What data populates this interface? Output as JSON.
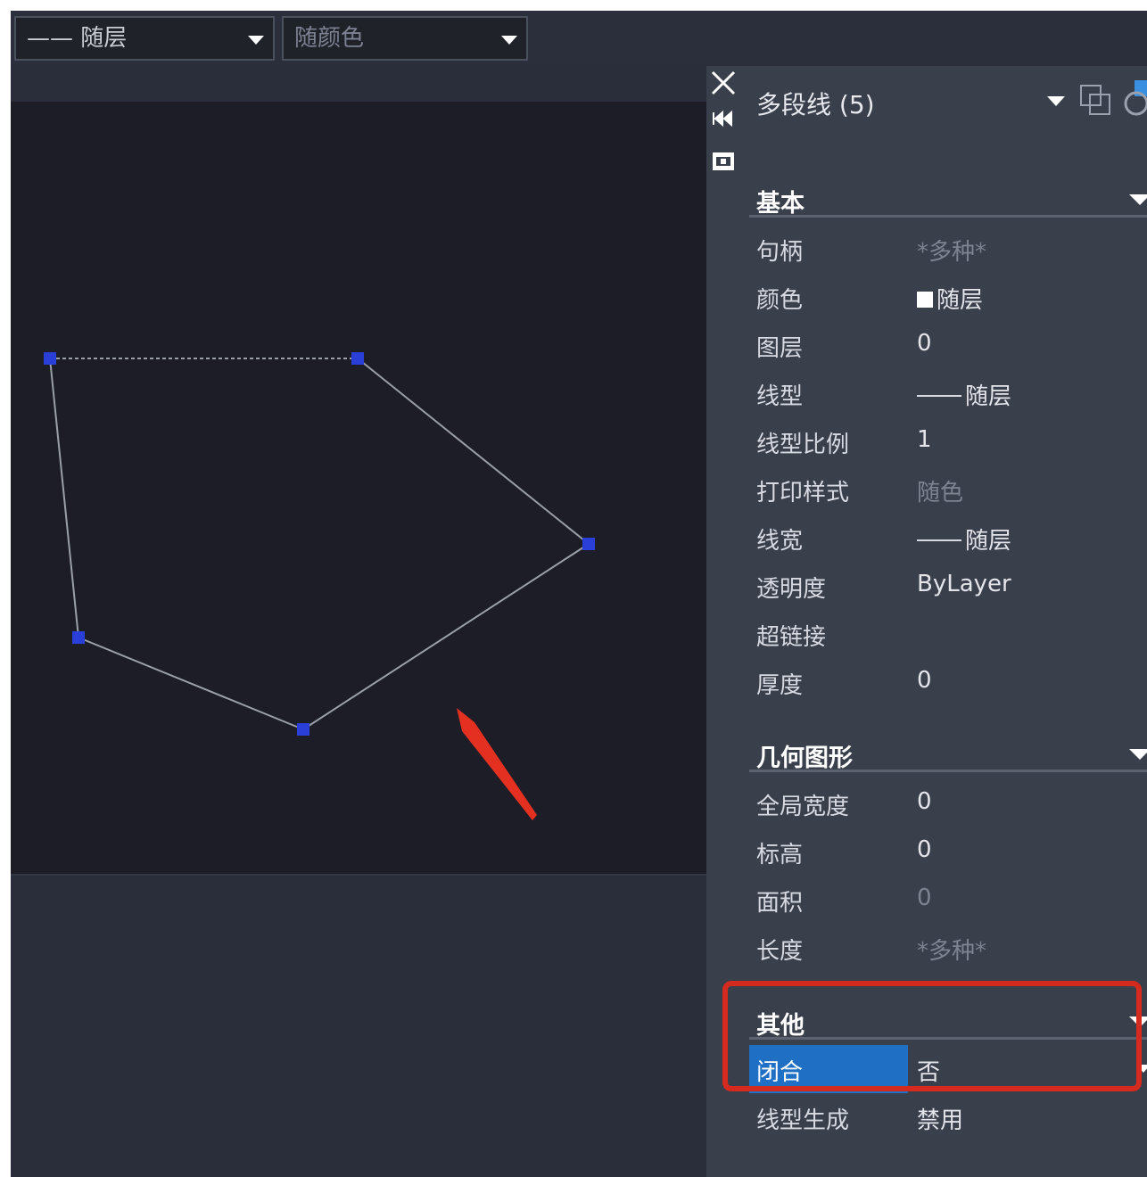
{
  "toolbar": {
    "linetype_combo": "—— 随层",
    "color_combo": "随颜色"
  },
  "panel": {
    "title": "多段线 (5)",
    "icons": [
      "close-icon",
      "pin-icon",
      "quick-properties-icon",
      "dropdown-icon",
      "select-objects-icon",
      "toggle-pickadd-icon"
    ],
    "sections": {
      "basic": {
        "title": "基本",
        "rows": [
          {
            "label": "句柄",
            "value": "*多种*"
          },
          {
            "label": "颜色",
            "value": "随层"
          },
          {
            "label": "图层",
            "value": "0"
          },
          {
            "label": "线型",
            "value": "随层"
          },
          {
            "label": "线型比例",
            "value": "1"
          },
          {
            "label": "打印样式",
            "value": "随色"
          },
          {
            "label": "线宽",
            "value": "随层"
          },
          {
            "label": "透明度",
            "value": "ByLayer"
          },
          {
            "label": "超链接",
            "value": ""
          },
          {
            "label": "厚度",
            "value": "0"
          }
        ]
      },
      "geometry": {
        "title": "几何图形",
        "rows": [
          {
            "label": "全局宽度",
            "value": "0"
          },
          {
            "label": "标高",
            "value": "0"
          },
          {
            "label": "面积",
            "value": "0"
          },
          {
            "label": "长度",
            "value": "*多种*"
          }
        ]
      },
      "misc": {
        "title": "其他",
        "rows": [
          {
            "label": "闭合",
            "value": "否"
          },
          {
            "label": "线型生成",
            "value": "禁用"
          }
        ]
      }
    }
  },
  "colors": {
    "canvas_bg": "#1c1d26",
    "panel_bg": "#3a3f4c",
    "selection": "#1f6fc4",
    "highlight": "#d42b1e",
    "grip": "#2a3fd8",
    "polyline": "#9a9fa8"
  }
}
